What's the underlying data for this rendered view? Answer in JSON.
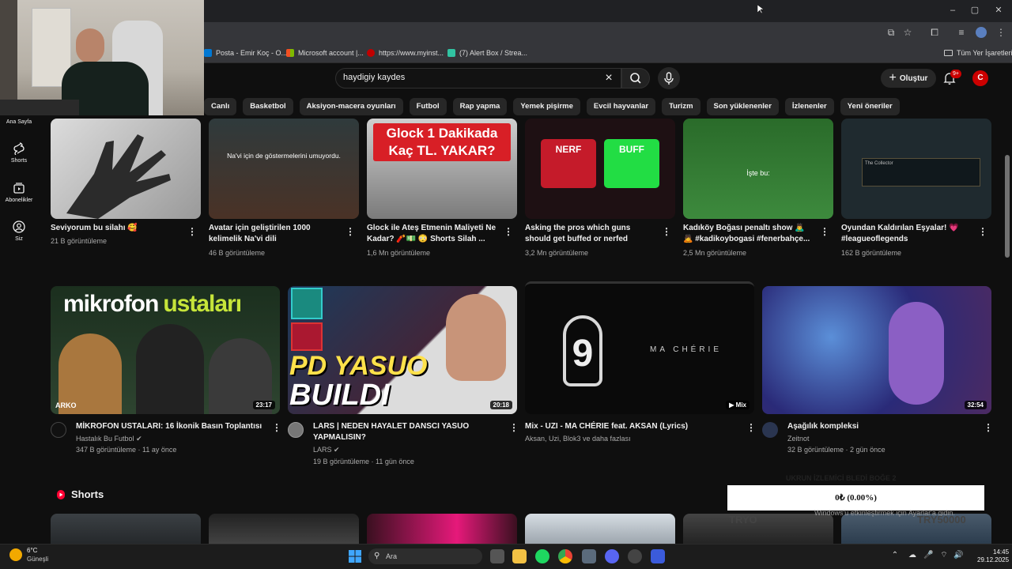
{
  "browser": {
    "window_controls": [
      "–",
      "▢",
      "✕"
    ],
    "bookmarks": [
      {
        "label": "Posta - Emir Koç - O...",
        "color": "#0078d4"
      },
      {
        "label": "Microsoft account |...",
        "color": "#f25022"
      },
      {
        "label": "https://www.myinst...",
        "color": "#c00000"
      },
      {
        "label": "(7) Alert Box / Strea...",
        "color": "#31c3a2"
      }
    ],
    "all_bookmarks": "Tüm Yer İşaretleri"
  },
  "header": {
    "search_value": "haydigiy kaydes",
    "create_label": "Oluştur",
    "notification_badge": "9+",
    "avatar_letter": "C"
  },
  "chips": [
    "Canlı",
    "Basketbol",
    "Aksiyon-macera oyunları",
    "Futbol",
    "Rap yapma",
    "Yemek pişirme",
    "Evcil hayvanlar",
    "Turizm",
    "Son yüklenenler",
    "İzlenenler",
    "Yeni öneriler"
  ],
  "sidebar": {
    "items": [
      {
        "label": "Ana Sayfa",
        "icon": "home-icon"
      },
      {
        "label": "Shorts",
        "icon": "shorts-icon"
      },
      {
        "label": "Abonelikler",
        "icon": "subscriptions-icon"
      },
      {
        "label": "Siz",
        "icon": "you-icon"
      }
    ]
  },
  "top_row": [
    {
      "title1": "Seviyorum bu silahı 🥰",
      "title2": "",
      "views": "21 B görüntüleme",
      "thumb_text": ""
    },
    {
      "title1": "Avatar için geliştirilen 1000",
      "title2": "kelimelik Na'vi dili",
      "views": "46 B görüntüleme",
      "thumb_text": "Na'vi için de göstermelerini umuyordu."
    },
    {
      "title1": "Glock ile Ateş Etmenin Maliyeti Ne",
      "title2": "Kadar? 🧨💵 😳 Shorts Silah ...",
      "views": "1,6 Mn görüntüleme",
      "thumb_text": "Glock 1 Dakikada Kaç TL. YAKAR?"
    },
    {
      "title1": "Asking the pros which guns",
      "title2": "should get buffed or nerfed",
      "views": "3,2 Mn görüntüleme",
      "thumb_text_a": "NERF",
      "thumb_text_b": "BUFF"
    },
    {
      "title1": "Kadıköy Boğası penaltı show 🙇‍♂️",
      "title2": "🙇 #kadikoybogasi #fenerbahçe...",
      "views": "2,5 Mn görüntüleme",
      "thumb_text": "İşte bu:"
    },
    {
      "title1": "Oyundan Kaldırılan Eşyalar! 💗",
      "title2": "#leagueoflegends",
      "views": "162 B görüntüleme",
      "thumb_text": "The Collector"
    }
  ],
  "main_row": [
    {
      "title1": "MİKROFON USTALARI: 16 İkonik Basın Toplantısı",
      "title2": "",
      "channel": "Hastalık Bu Futbol",
      "meta": "347 B görüntüleme · 11 ay önce",
      "duration": "23:17",
      "thumb_text_a": "mikrofon",
      "thumb_text_b": "ustaları",
      "corner": "ARKO"
    },
    {
      "title1": "LARS | NEDEN HAYALET DANSCI YASUO",
      "title2": "YAPMALISIN?",
      "channel": "LARS",
      "meta": "19 B görüntüleme · 11 gün önce",
      "duration": "20:18",
      "thumb_text_a": "PD YASUO",
      "thumb_text_b": "BUILDI"
    },
    {
      "title1": "Mix - UZI - MA CHÉRIE feat. AKSAN (Lyrics)",
      "title2": "",
      "channel": "Aksan, Uzi, Blok3 ve daha fazlası",
      "meta": "",
      "duration": "Mix",
      "thumb_text_a": "MA CHÉRIE",
      "thumb_text_b": "9"
    },
    {
      "title1": "Aşağılık kompleksi",
      "title2": "",
      "channel": "Zeitnot",
      "meta": "32 B görüntüleme · 2 gün önce",
      "duration": "32:54"
    }
  ],
  "shorts": {
    "title": "Shorts"
  },
  "overlay": {
    "donation_label": "UKRUN İZLEMİCİ BLEDİ BOĞE 2",
    "donation_value": "0₺ (0.00%)",
    "activate": "Windows'u etkinleştirmek için Ayarlar'a gidin.",
    "try_left": "TRYO",
    "try_right": "TRY50000"
  },
  "taskbar": {
    "temp": "6°C",
    "weather": "Güneşli",
    "search": "Ara",
    "time": "14:45",
    "date": "29.12.2025"
  }
}
